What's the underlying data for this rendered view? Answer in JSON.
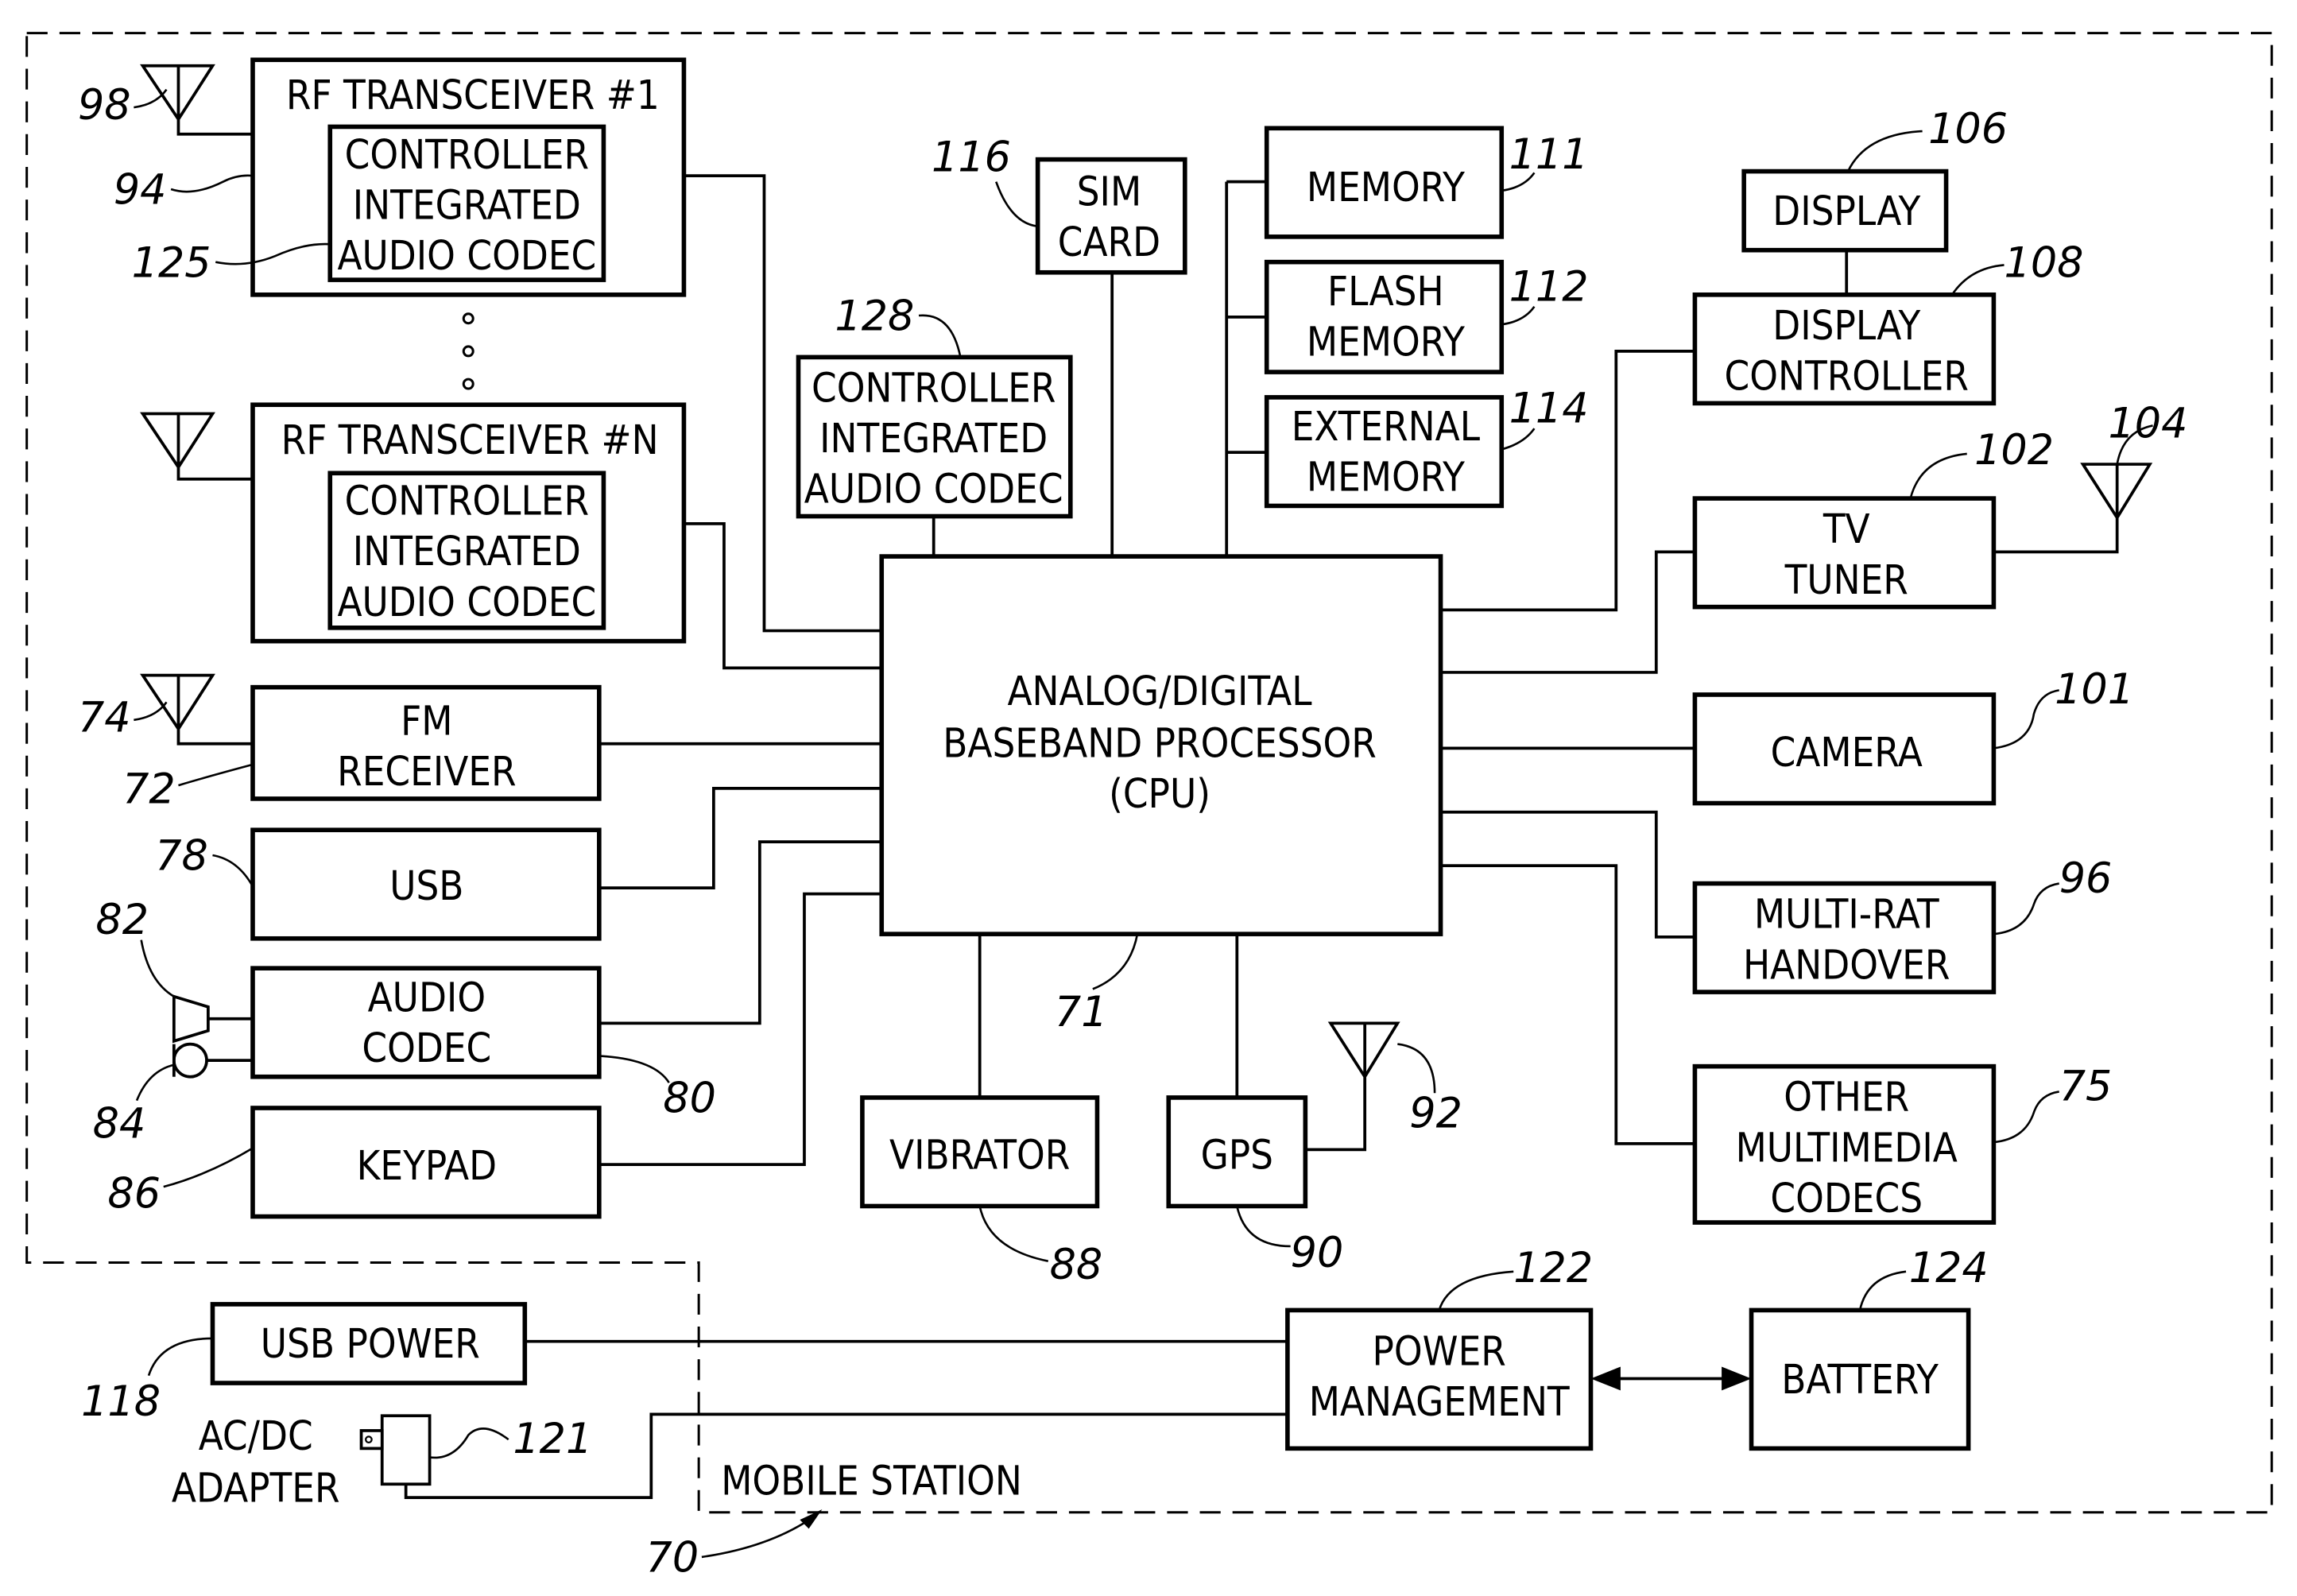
{
  "diagram": {
    "title": "MOBILE STATION",
    "ref": "70",
    "blocks": {
      "rf1": {
        "title": "RF TRANSCEIVER #1",
        "inner": [
          "CONTROLLER",
          "INTEGRATED",
          "AUDIO CODEC"
        ],
        "ref": "94",
        "inner_ref": "125",
        "antenna_ref": "98"
      },
      "rfn": {
        "title": "RF TRANSCEIVER #N",
        "inner": [
          "CONTROLLER",
          "INTEGRATED",
          "AUDIO CODEC"
        ]
      },
      "fm": {
        "lines": [
          "FM",
          "RECEIVER"
        ],
        "ref": "72",
        "antenna_ref": "74"
      },
      "usb": {
        "lines": [
          "USB"
        ],
        "ref": "78"
      },
      "audio": {
        "lines": [
          "AUDIO",
          "CODEC"
        ],
        "ref": "80",
        "speaker_ref": "82",
        "mic_ref": "84"
      },
      "keypad": {
        "lines": [
          "KEYPAD"
        ],
        "ref": "86"
      },
      "ctrl128": {
        "lines": [
          "CONTROLLER",
          "INTEGRATED",
          "AUDIO CODEC"
        ],
        "ref": "128"
      },
      "sim": {
        "lines": [
          "SIM",
          "CARD"
        ],
        "ref": "116"
      },
      "memory": {
        "lines": [
          "MEMORY"
        ],
        "ref": "111"
      },
      "flash": {
        "lines": [
          "FLASH",
          "MEMORY"
        ],
        "ref": "112"
      },
      "external": {
        "lines": [
          "EXTERNAL",
          "MEMORY"
        ],
        "ref": "114"
      },
      "cpu": {
        "lines": [
          "ANALOG/DIGITAL",
          "BASEBAND PROCESSOR",
          "(CPU)"
        ],
        "ref": "71"
      },
      "display": {
        "lines": [
          "DISPLAY"
        ],
        "ref": "106"
      },
      "display_ctrl": {
        "lines": [
          "DISPLAY",
          "CONTROLLER"
        ],
        "ref": "108"
      },
      "tv": {
        "lines": [
          "TV",
          "TUNER"
        ],
        "ref": "102",
        "antenna_ref": "104"
      },
      "camera": {
        "lines": [
          "CAMERA"
        ],
        "ref": "101"
      },
      "multirat": {
        "lines": [
          "MULTI-RAT",
          "HANDOVER"
        ],
        "ref": "96"
      },
      "othermm": {
        "lines": [
          "OTHER",
          "MULTIMEDIA",
          "CODECS"
        ],
        "ref": "75"
      },
      "vibrator": {
        "lines": [
          "VIBRATOR"
        ],
        "ref": "88"
      },
      "gps": {
        "lines": [
          "GPS"
        ],
        "ref": "90",
        "antenna_ref": "92"
      },
      "usbpower": {
        "lines": [
          "USB POWER"
        ],
        "ref": "118"
      },
      "acdc": {
        "lines": [
          "AC/DC",
          "ADAPTER"
        ],
        "ref": "121"
      },
      "power": {
        "lines": [
          "POWER",
          "MANAGEMENT"
        ],
        "ref": "122"
      },
      "battery": {
        "lines": [
          "BATTERY"
        ],
        "ref": "124"
      }
    }
  }
}
